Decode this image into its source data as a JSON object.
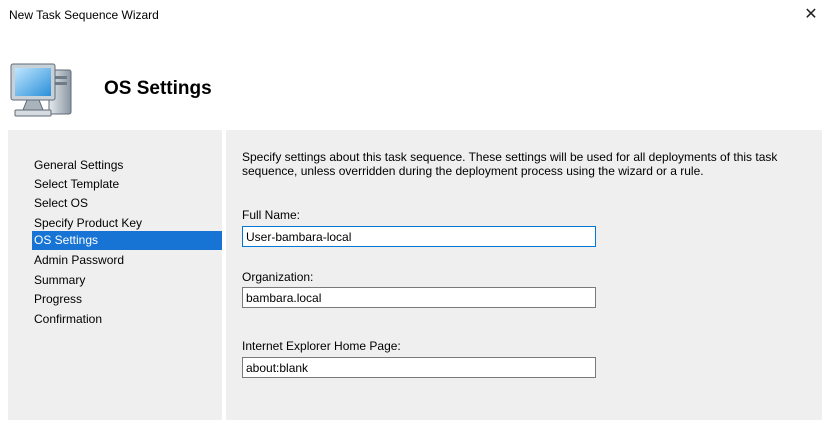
{
  "window": {
    "title": "New Task Sequence Wizard",
    "close_glyph": "✕"
  },
  "header": {
    "title": "OS Settings",
    "icon": "computer-icon"
  },
  "nav": {
    "items": [
      {
        "label": "General Settings"
      },
      {
        "label": "Select Template"
      },
      {
        "label": "Select OS"
      },
      {
        "label": "Specify Product Key"
      },
      {
        "label": "OS Settings",
        "selected": true
      },
      {
        "label": "Admin Password"
      },
      {
        "label": "Summary"
      },
      {
        "label": "Progress"
      },
      {
        "label": "Confirmation"
      }
    ],
    "selected_color": "#1874d4"
  },
  "content": {
    "description": "Specify settings about this task sequence.  These settings will be used for all deployments of this task sequence, unless overridden during the deployment process using the wizard or a rule.",
    "full_name": {
      "label": "Full Name:",
      "value": "User-bambara-local"
    },
    "organization": {
      "label": "Organization:",
      "value": "bambara.local"
    },
    "home_page": {
      "label": "Internet Explorer Home Page:",
      "value": "about:blank"
    }
  }
}
